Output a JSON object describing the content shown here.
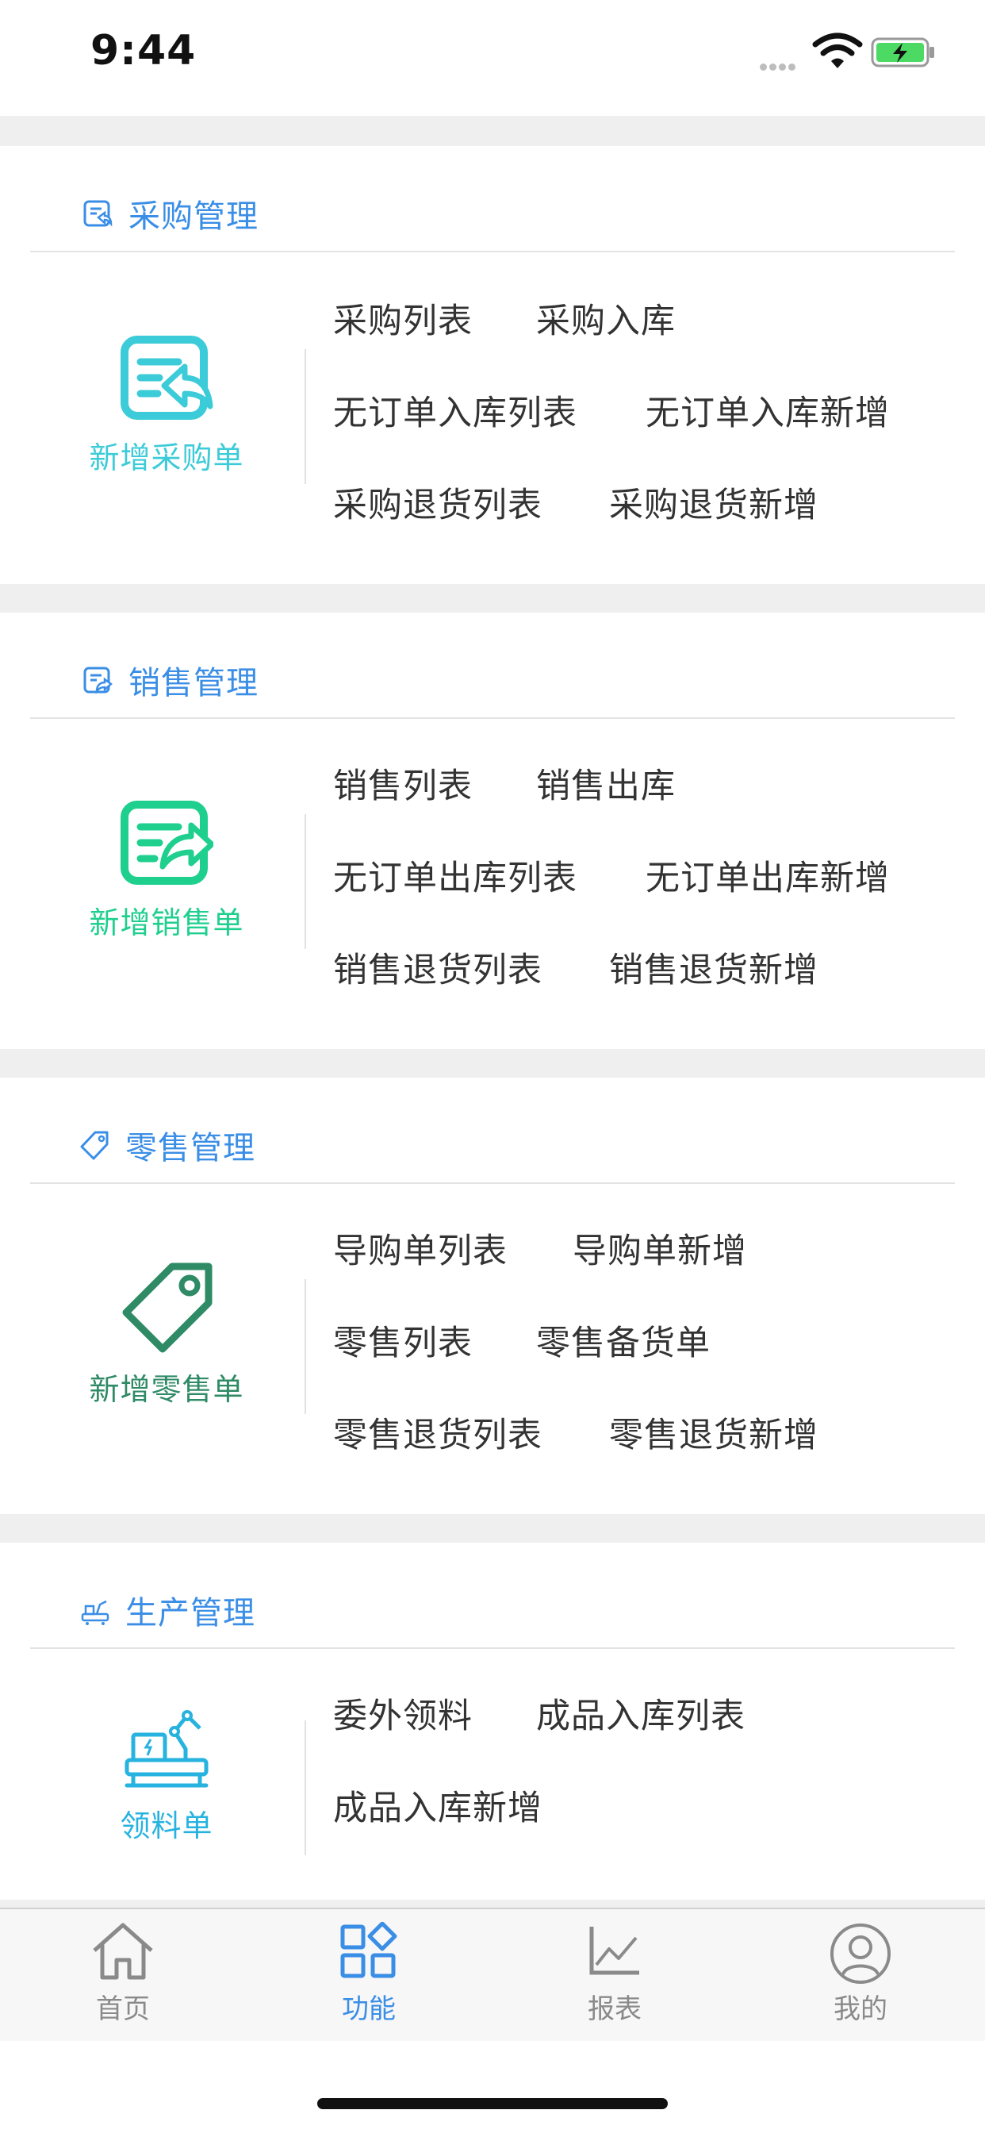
{
  "status_bar": {
    "time": "9:44"
  },
  "sections": [
    {
      "title": "采购管理",
      "action": "新增采购单",
      "color": "#3ccbd8",
      "rows": [
        [
          "采购列表",
          "采购入库"
        ],
        [
          "无订单入库列表",
          "无订单入库新增"
        ],
        [
          "采购退货列表",
          "采购退货新增"
        ]
      ]
    },
    {
      "title": "销售管理",
      "action": "新增销售单",
      "color": "#1fcf8e",
      "rows": [
        [
          "销售列表",
          "销售出库"
        ],
        [
          "无订单出库列表",
          "无订单出库新增"
        ],
        [
          "销售退货列表",
          "销售退货新增"
        ]
      ]
    },
    {
      "title": "零售管理",
      "action": "新增零售单",
      "color": "#2f8a66",
      "rows": [
        [
          "导购单列表",
          "导购单新增"
        ],
        [
          "零售列表",
          "零售备货单"
        ],
        [
          "零售退货列表",
          "零售退货新增"
        ]
      ]
    },
    {
      "title": "生产管理",
      "action": "领料单",
      "color": "#27b3df",
      "rows": [
        [
          "委外领料",
          "成品入库列表"
        ],
        [
          "成品入库新增"
        ]
      ]
    }
  ],
  "tabs": [
    {
      "label": "首页",
      "icon": "home-icon"
    },
    {
      "label": "功能",
      "icon": "grid-icon",
      "active": true
    },
    {
      "label": "报表",
      "icon": "chart-icon"
    },
    {
      "label": "我的",
      "icon": "user-icon"
    }
  ],
  "colors": {
    "accent": "#3a8ee6",
    "text": "#333333",
    "background": "#efefef"
  }
}
